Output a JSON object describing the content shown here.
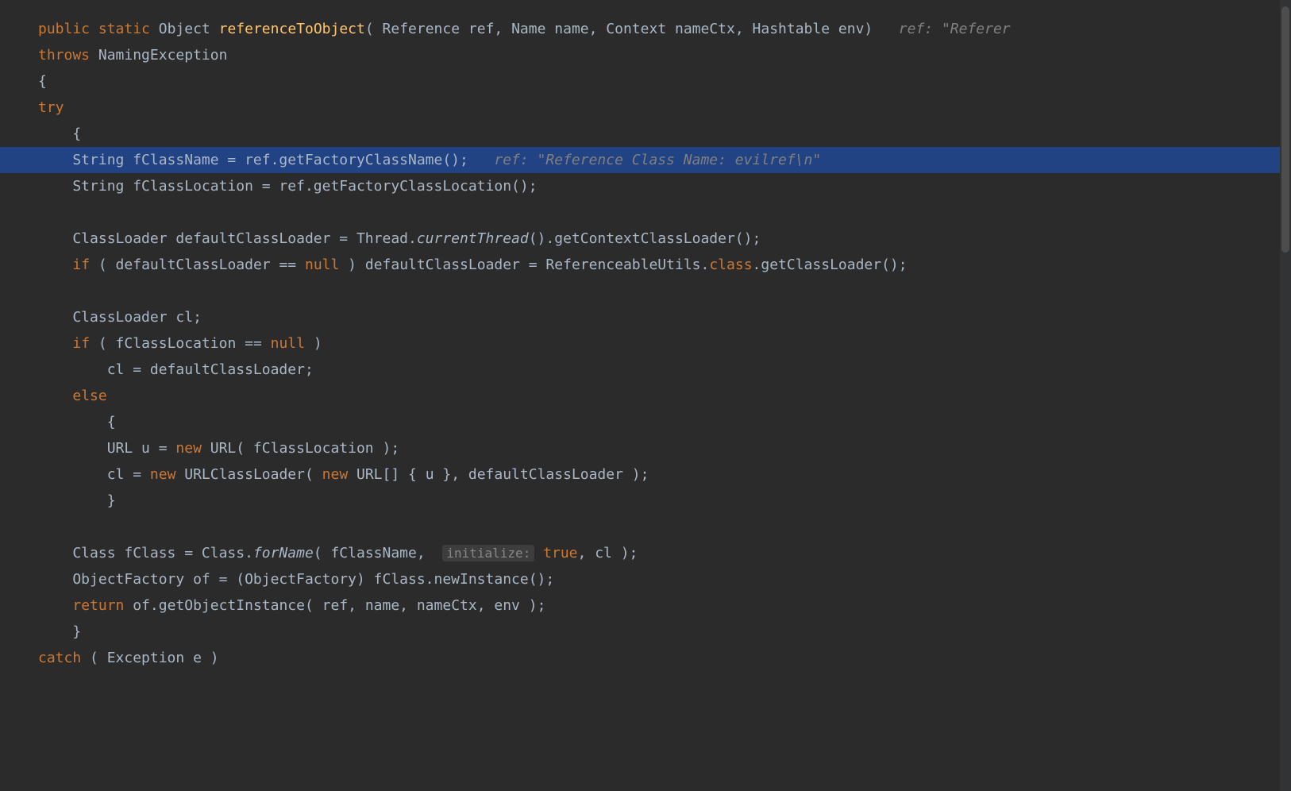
{
  "lines": {
    "l1_kw1": "public",
    "l1_kw2": "static",
    "l1_type": "Object",
    "l1_method": "referenceToObject",
    "l1_params": "( Reference ref, Name name, Context nameCtx, Hashtable env)",
    "l1_comment": "ref: \"Referer",
    "l2_kw": "throws",
    "l2_type": "NamingException",
    "l3": "{",
    "l4": "try",
    "l5": "    {",
    "l6_pre": "    String fClassName = ref.getFactoryClassName();",
    "l6_comment": "ref: \"Reference Class Name: evilref\\n\"",
    "l7": "    String fClassLocation = ref.getFactoryClassLocation();",
    "l8_pre": "    ClassLoader defaultClassLoader = Thread.",
    "l8_static": "currentThread",
    "l8_post": "().getContextClassLoader();",
    "l9_kw_if": "if",
    "l9_pre": " ( defaultClassLoader == ",
    "l9_null": "null",
    "l9_mid": " ) defaultClassLoader = ReferenceableUtils.",
    "l9_class": "class",
    "l9_post": ".getClassLoader();",
    "l10": "    ClassLoader cl;",
    "l11_kw": "if",
    "l11_rest": " ( fClassLocation == ",
    "l11_null": "null",
    "l11_end": " )",
    "l12": "        cl = defaultClassLoader;",
    "l13": "else",
    "l14": "        {",
    "l15_pre": "        URL u = ",
    "l15_new": "new",
    "l15_post": " URL( fClassLocation );",
    "l16_pre": "        cl = ",
    "l16_new1": "new",
    "l16_mid": " URLClassLoader( ",
    "l16_new2": "new",
    "l16_post": " URL[] { u }, defaultClassLoader );",
    "l17": "        }",
    "l18_pre": "    Class fClass = Class.",
    "l18_static": "forName",
    "l18_mid": "( fClassName, ",
    "l18_hint": "initialize:",
    "l18_true": "true",
    "l18_post": ", cl );",
    "l19": "    ObjectFactory of = (ObjectFactory) fClass.newInstance();",
    "l20_kw": "return",
    "l20_rest": " of.getObjectInstance( ref, name, nameCtx, env );",
    "l21": "    }",
    "l22_kw": "catch",
    "l22_rest": " ( Exception e )"
  }
}
